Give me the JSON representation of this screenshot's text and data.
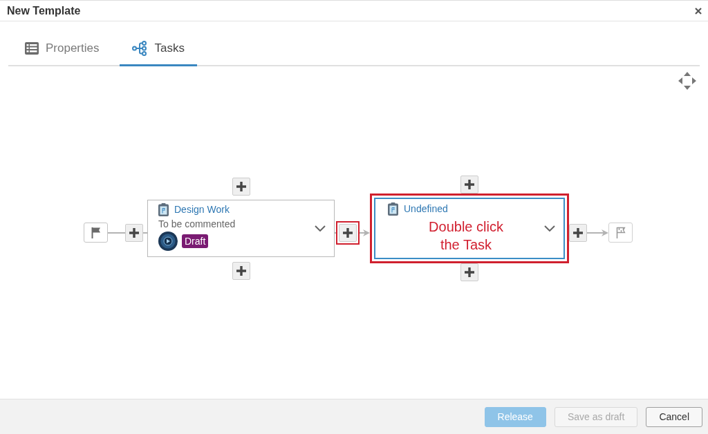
{
  "window": {
    "title": "New Template"
  },
  "tabs": [
    {
      "label": "Properties",
      "selected": false
    },
    {
      "label": "Tasks",
      "selected": true
    }
  ],
  "flow": [
    {
      "kind": "start"
    },
    {
      "kind": "add",
      "highlighted": false
    },
    {
      "kind": "task",
      "title": "Design Work",
      "status": "To be commented",
      "badge": "Draft",
      "selected": false,
      "highlighted": false
    },
    {
      "kind": "add",
      "highlighted": true
    },
    {
      "kind": "task",
      "title": "Undefined",
      "annotation": "Double click the Task",
      "selected": true,
      "highlighted": true
    },
    {
      "kind": "add",
      "highlighted": false
    },
    {
      "kind": "end"
    }
  ],
  "buttons": [
    {
      "label": "Release",
      "kind": "primary",
      "disabled": true
    },
    {
      "label": "Save as draft",
      "kind": "default",
      "disabled": true
    },
    {
      "label": "Cancel",
      "kind": "default",
      "disabled": false
    }
  ]
}
